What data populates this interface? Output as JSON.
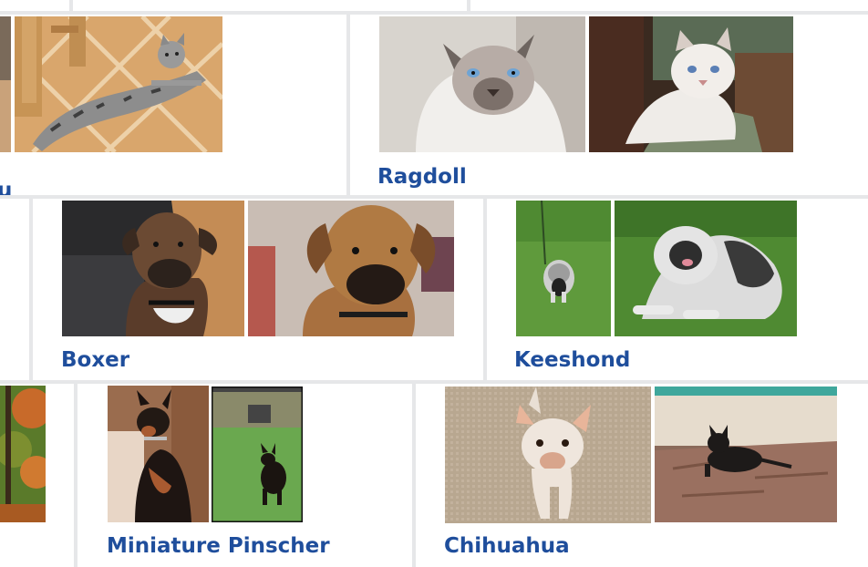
{
  "gallery": {
    "row1": {
      "left_breed_label_partial": "u",
      "ragdoll_label": "Ragdoll"
    },
    "row2": {
      "boxer_label": "Boxer",
      "keeshond_label": "Keeshond"
    },
    "row3": {
      "min_pinscher_label": "Miniature Pinscher",
      "chihuahua_label": "Chihuahua"
    }
  },
  "images": [
    "egyptian-mau-cat-photo",
    "ragdoll-cat-photo",
    "ragdoll-kitten-photo",
    "boxer-dog-photo",
    "boxer-dog-closeup-photo",
    "keeshond-running-photo",
    "keeshond-lying-photo",
    "autumn-tree-photo-partial",
    "miniature-pinscher-sitting-photo",
    "miniature-pinscher-running-photo",
    "chihuahua-white-photo",
    "chihuahua-black-photo"
  ]
}
